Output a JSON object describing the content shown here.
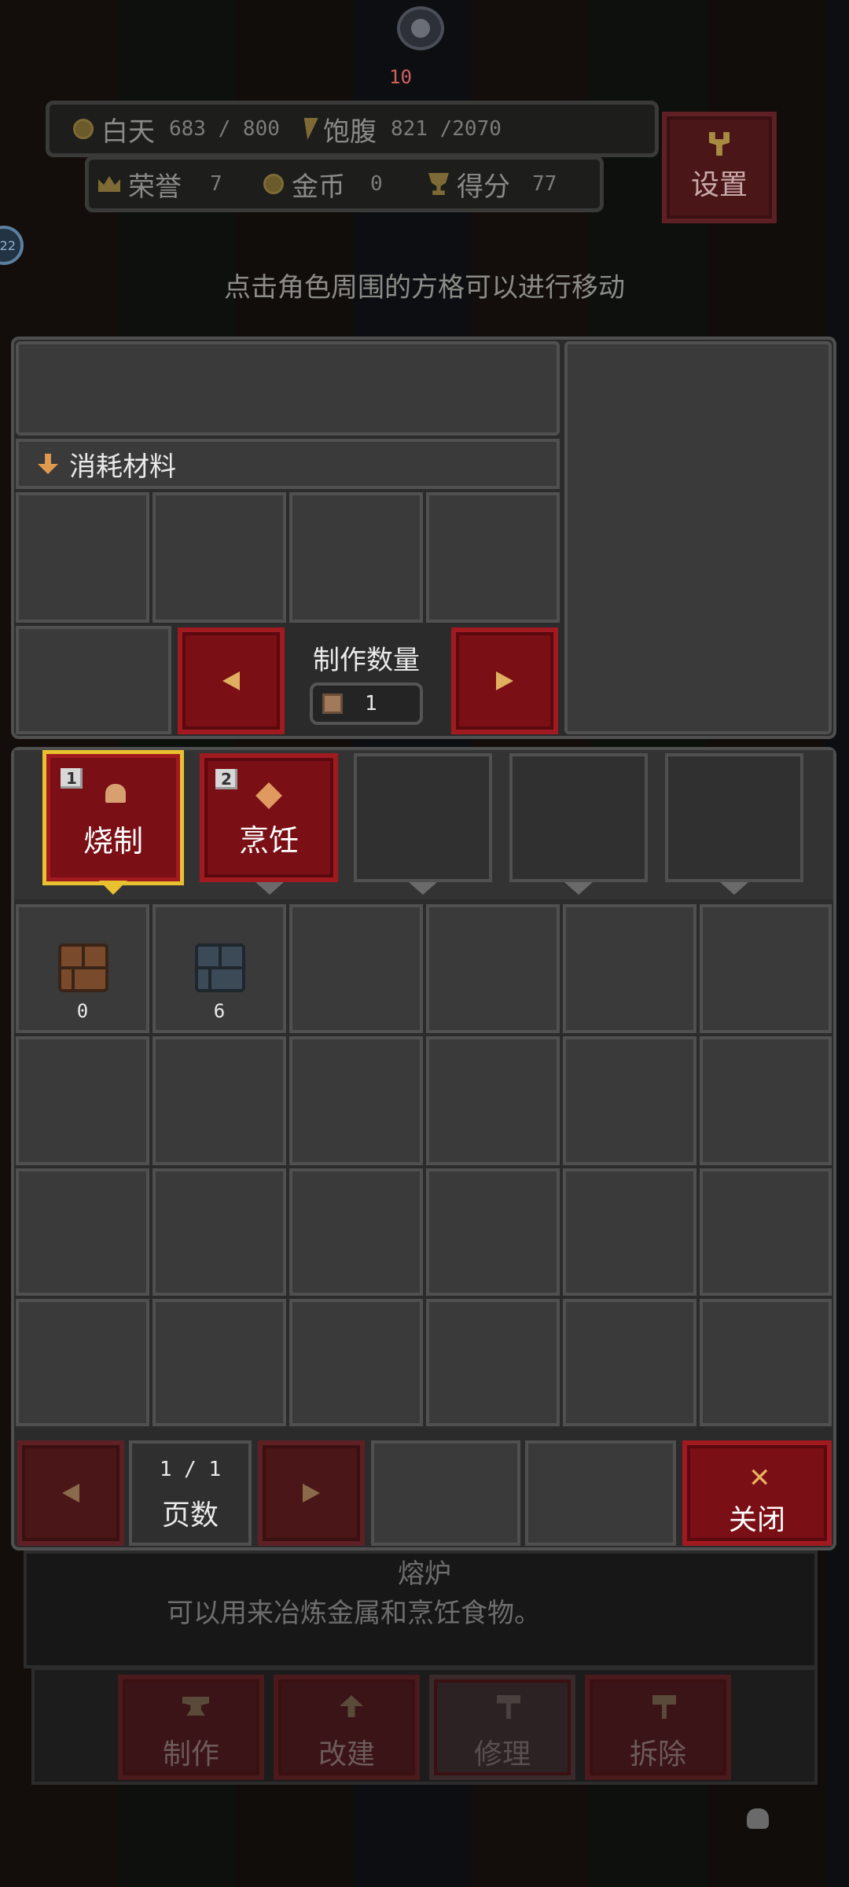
{
  "hud": {
    "player_marker": "10",
    "day_label": "白天",
    "day_value": "683 / 800",
    "full_label": "饱腹",
    "full_value": "821 /2070",
    "honor_label": "荣誉",
    "honor_value": "7",
    "gold_label": "金币",
    "gold_value": "0",
    "score_label": "得分",
    "score_value": "77",
    "settings_label": "设置",
    "side_badge": "22"
  },
  "hint": "点击角色周围的方格可以进行移动",
  "craft": {
    "materials_label": "消耗材料",
    "quantity_label": "制作数量",
    "quantity_value": "1"
  },
  "tabs": [
    {
      "num": "1",
      "label": "烧制",
      "icon": "bread-icon",
      "selected": true
    },
    {
      "num": "2",
      "label": "烹饪",
      "icon": "diamond-icon",
      "selected": false
    }
  ],
  "items": [
    {
      "icon": "brick-icon",
      "count": "0",
      "color": "#7a4a2c"
    },
    {
      "icon": "stone-brick-icon",
      "count": "6",
      "color": "#3c4a58"
    }
  ],
  "pager": {
    "page_value": "1 / 1",
    "page_label": "页数",
    "close_label": "关闭"
  },
  "building": {
    "name": "熔炉",
    "description": "可以用来冶炼金属和烹饪食物。"
  },
  "actions": [
    "制作",
    "改建",
    "修理",
    "拆除"
  ],
  "colors": {
    "accent_red": "#7a0f15",
    "selected_gold": "#e8c030",
    "panel_gray": "#2b2b2b"
  }
}
